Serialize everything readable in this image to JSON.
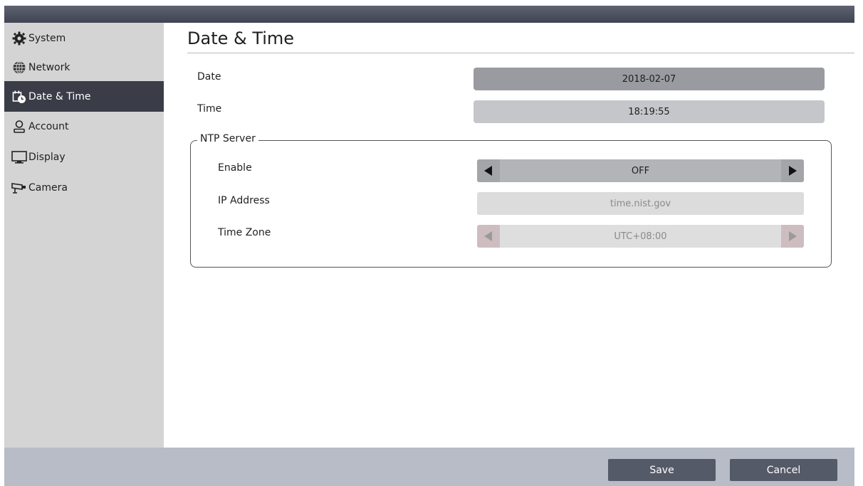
{
  "sidebar": {
    "items": [
      {
        "label": "System",
        "icon": "gear-icon"
      },
      {
        "label": "Network",
        "icon": "globe-icon"
      },
      {
        "label": "Date & Time",
        "icon": "calendar-clock-icon",
        "active": true
      },
      {
        "label": "Account",
        "icon": "user-icon"
      },
      {
        "label": "Display",
        "icon": "monitor-icon"
      },
      {
        "label": "Camera",
        "icon": "camera-icon"
      }
    ]
  },
  "main": {
    "title": "Date & Time",
    "date_label": "Date",
    "date_value": "2018-02-07",
    "time_label": "Time",
    "time_value": "18:19:55",
    "ntp": {
      "legend": "NTP Server",
      "enable_label": "Enable",
      "enable_value": "OFF",
      "ip_label": "IP Address",
      "ip_value": "time.nist.gov",
      "tz_label": "Time Zone",
      "tz_value": "UTC+08:00"
    }
  },
  "footer": {
    "save_label": "Save",
    "cancel_label": "Cancel"
  },
  "colors": {
    "active_nav": "#3a3d47",
    "button": "#555a68",
    "footer": "#b7bcc6"
  }
}
